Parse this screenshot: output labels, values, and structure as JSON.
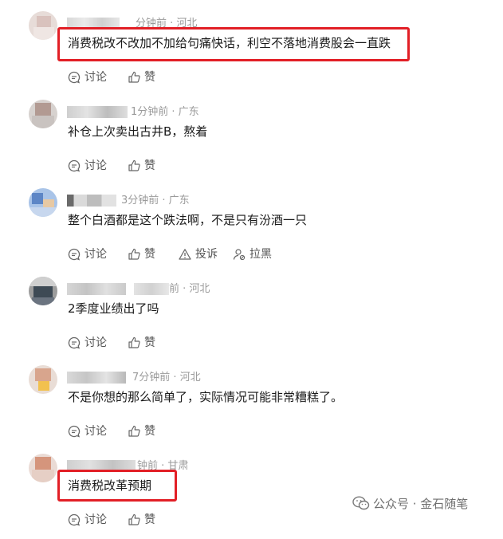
{
  "actions": {
    "comment": "讨论",
    "like": "赞",
    "report": "投诉",
    "block": "拉黑"
  },
  "comments": [
    {
      "time_location": "分钟前 · 河北",
      "text": "消费税改不改加不加给句痛快话，利空不落地消费股会一直跌"
    },
    {
      "time_location": "1分钟前 · 广东",
      "text": "补仓上次卖出古井B，熬着"
    },
    {
      "time_location": "3分钟前 · 广东",
      "text": "整个白酒都是这个跌法啊，不是只有汾酒一只"
    },
    {
      "time_location": "前 · 河北",
      "text": "2季度业绩出了吗"
    },
    {
      "time_location": "7分钟前 · 河北",
      "text": "不是你想的那么简单了，实际情况可能非常糟糕了。"
    },
    {
      "time_location": "钟前 · 甘肃",
      "text": "消费税改革预期"
    }
  ],
  "watermark": {
    "source": "公众号 · 金石随笔",
    "icon": "wechat-icon"
  },
  "colors": {
    "highlight": "#e21f26",
    "meta": "#9a9a9a",
    "text": "#1a1a1a"
  }
}
